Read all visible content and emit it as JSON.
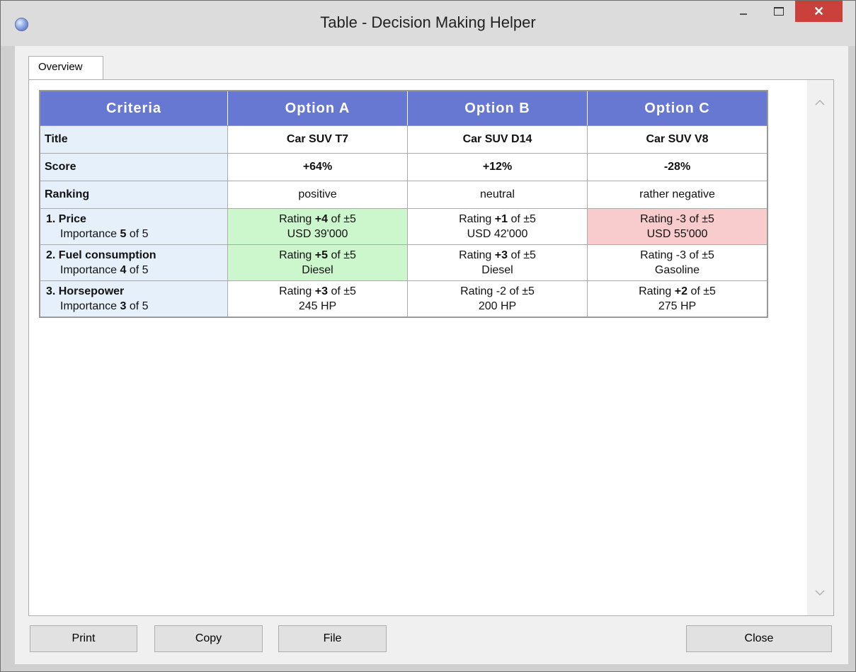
{
  "window": {
    "title": "Table - Decision Making Helper",
    "close_glyph": "✕"
  },
  "tabs": [
    {
      "label": "Overview"
    }
  ],
  "table": {
    "headers": [
      "Criteria",
      "Option A",
      "Option B",
      "Option C"
    ],
    "title_row": {
      "label": "Title",
      "values": [
        "Car SUV T7",
        "Car SUV D14",
        "Car SUV V8"
      ]
    },
    "score_row": {
      "label": "Score",
      "values": [
        "+64%",
        "+12%",
        "-28%"
      ]
    },
    "ranking_row": {
      "label": "Ranking",
      "values": [
        "positive",
        "neutral",
        "rather negative"
      ]
    },
    "criteria": [
      {
        "name": "1. Price",
        "importance_prefix": "Importance ",
        "importance": "5",
        "importance_suffix": " of 5",
        "cells": [
          {
            "rating": "+4",
            "detail": "USD 39'000",
            "status": "positive"
          },
          {
            "rating": "+1",
            "detail": "USD 42'000",
            "status": "neutral"
          },
          {
            "rating": "-3",
            "detail": "USD 55'000",
            "status": "negative"
          }
        ]
      },
      {
        "name": "2. Fuel consumption",
        "importance_prefix": "Importance ",
        "importance": "4",
        "importance_suffix": " of 5",
        "cells": [
          {
            "rating": "+5",
            "detail": "Diesel",
            "status": "positive"
          },
          {
            "rating": "+3",
            "detail": "Diesel",
            "status": "neutral"
          },
          {
            "rating": "-3",
            "detail": "Gasoline",
            "status": "neutral"
          }
        ]
      },
      {
        "name": "3. Horsepower",
        "importance_prefix": "Importance ",
        "importance": "3",
        "importance_suffix": " of 5",
        "cells": [
          {
            "rating": "+3",
            "detail": "245 HP",
            "status": "neutral"
          },
          {
            "rating": "-2",
            "detail": "200 HP",
            "status": "neutral"
          },
          {
            "rating": "+2",
            "detail": "275 HP",
            "status": "neutral"
          }
        ]
      }
    ],
    "rating_prefix": "Rating ",
    "rating_suffix": " of ±5"
  },
  "buttons": {
    "print": "Print",
    "copy": "Copy",
    "file": "File",
    "close": "Close"
  },
  "colors": {
    "header": "#6778d2",
    "criteria_bg": "#e6f0fb",
    "positive": "#ccf6cc",
    "negative": "#f8cccc"
  },
  "icons": {
    "app": "app-globe-icon",
    "scroll_up": "chevron-up-icon",
    "scroll_down": "chevron-down-icon"
  }
}
